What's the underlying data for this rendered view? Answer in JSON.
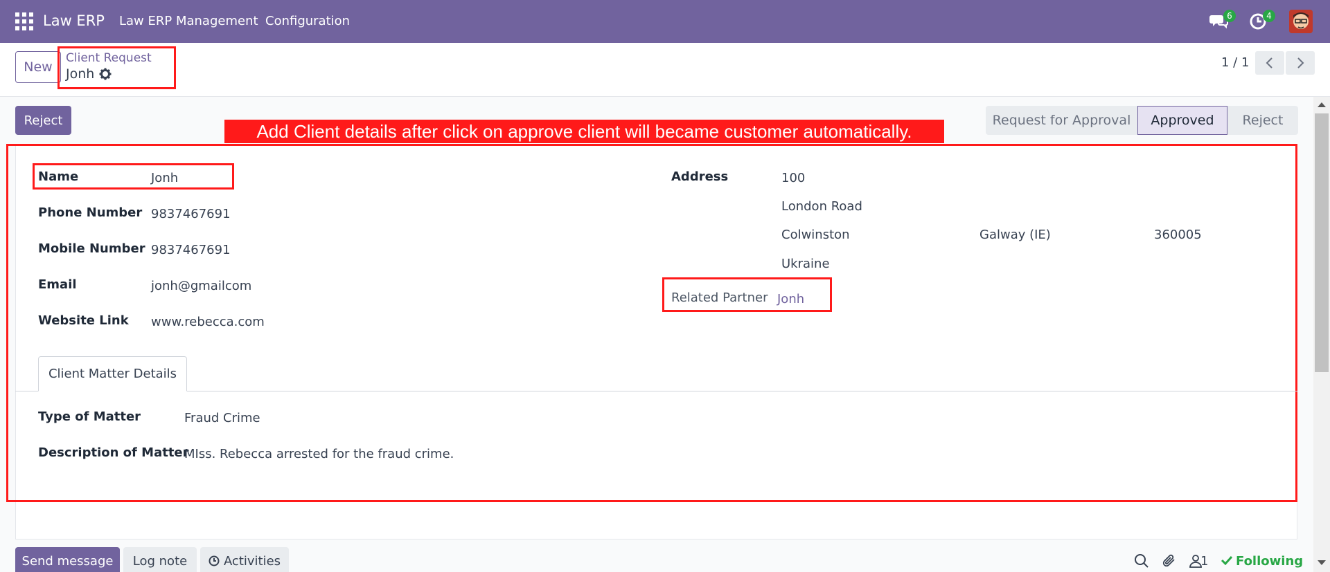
{
  "navbar": {
    "brand": "Law ERP",
    "menus": [
      "Law ERP Management",
      "Configuration"
    ],
    "messages_badge": "6",
    "activities_badge": "4",
    "bg_color": "#71639e"
  },
  "control_panel": {
    "new_label": "New",
    "breadcrumb_parent": "Client Request",
    "breadcrumb_current": "Jonh",
    "pager": "1 / 1"
  },
  "actions": {
    "reject_label": "Reject"
  },
  "statusbar": {
    "stages": [
      "Request for Approval",
      "Approved",
      "Reject"
    ],
    "active": "Approved"
  },
  "annotation": "Add Client details after click on approve client will became customer automatically.",
  "form": {
    "left": [
      {
        "label": "Name",
        "value": "Jonh"
      },
      {
        "label": "Phone Number",
        "value": "9837467691"
      },
      {
        "label": "Mobile Number",
        "value": "9837467691"
      },
      {
        "label": "Email",
        "value": "jonh@gmailcom"
      },
      {
        "label": "Website Link",
        "value": "www.rebecca.com"
      }
    ],
    "address": {
      "label": "Address",
      "street": "100",
      "street2": "London Road",
      "city": "Colwinston",
      "state": "Galway (IE)",
      "zip": "360005",
      "country": "Ukraine"
    },
    "related_partner": {
      "label": "Related Partner",
      "value": "Jonh"
    }
  },
  "notebook": {
    "tab_label": "Client Matter Details",
    "fields": [
      {
        "label": "Type of Matter",
        "value": "Fraud Crime"
      },
      {
        "label": "Description of Matter",
        "value": "MIss. Rebecca arrested for the fraud crime."
      }
    ]
  },
  "chatter": {
    "send_message": "Send message",
    "log_note": "Log note",
    "activities": "Activities",
    "followers_count": "1",
    "following": "Following"
  },
  "colors": {
    "accent": "#71639e",
    "highlight_red": "#ff1a1a",
    "success": "#28a745"
  }
}
